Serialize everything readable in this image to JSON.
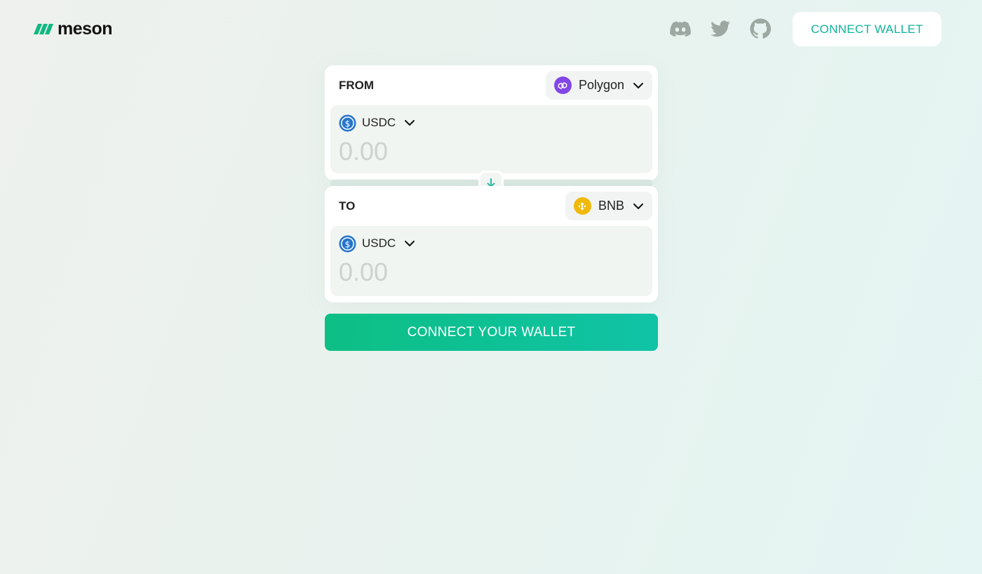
{
  "brand": {
    "name": "meson",
    "accent": "#12b39a"
  },
  "header": {
    "social_links": [
      {
        "icon": "discord-icon"
      },
      {
        "icon": "twitter-icon"
      },
      {
        "icon": "github-icon"
      }
    ],
    "connect_label": "CONNECT WALLET"
  },
  "swap": {
    "from": {
      "label": "FROM",
      "chain": "Polygon",
      "chain_icon": "polygon-icon",
      "chain_color": "#8247e5",
      "token": "USDC",
      "token_icon": "usdc-icon",
      "amount_placeholder": "0.00"
    },
    "to": {
      "label": "TO",
      "chain": "BNB",
      "chain_icon": "bnb-icon",
      "chain_color": "#f0b90b",
      "token": "USDC",
      "token_icon": "usdc-icon",
      "amount_placeholder": "0.00"
    },
    "swap_icon": "arrow-down-icon",
    "connect_label": "CONNECT YOUR WALLET"
  }
}
